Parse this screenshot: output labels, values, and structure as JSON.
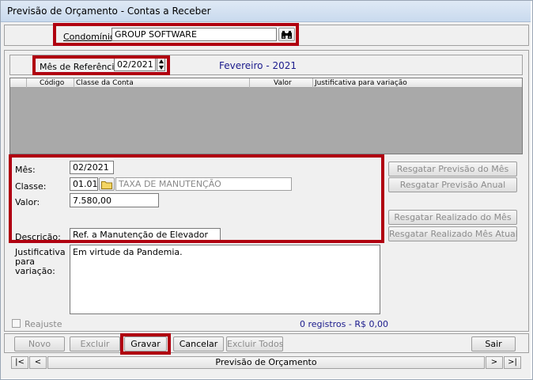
{
  "window": {
    "title": "Previsão de Orçamento - Contas a Receber"
  },
  "condominio": {
    "label": "Condomínio:",
    "value": "GROUP SOFTWARE",
    "search_icon": "binoculars-icon"
  },
  "referencia": {
    "label": "Mês de Referência:",
    "value": "02/2021",
    "display": "Fevereiro - 2021"
  },
  "grid": {
    "columns": [
      "Código",
      "Classe da Conta",
      "Valor",
      "Justificativa para variação"
    ]
  },
  "form": {
    "mes_label": "Mês:",
    "mes_value": "02/2021",
    "classe_label": "Classe:",
    "classe_code": "01.01",
    "classe_name": "TAXA DE MANUTENÇÃO",
    "valor_label": "Valor:",
    "valor_value": "7.580,00",
    "descricao_label": "Descrição:",
    "descricao_value": "Ref. a Manutenção de Elevador",
    "just_label_1": "Justificativa",
    "just_label_2": "para",
    "just_label_3": "variação:",
    "justificativa_value": "Em virtude da Pandemia."
  },
  "side_buttons": {
    "prev_mes": "Resgatar Previsão do Mês",
    "prev_anual": "Resgatar Previsão Anual",
    "real_mes": "Resgatar Realizado do Mês",
    "real_atual": "Resgatar Realizado Mês Atual"
  },
  "status": {
    "reajuste": "Reajuste",
    "registros": "0 registros - R$ 0,00"
  },
  "buttons": {
    "novo": "Novo",
    "excluir": "Excluir",
    "gravar": "Gravar",
    "cancelar": "Cancelar",
    "excluir_todos": "Excluir Todos",
    "sair": "Sair"
  },
  "navigator": {
    "first": "|<",
    "prev": "<",
    "label": "Previsão de Orçamento",
    "next": ">",
    "last": ">|"
  },
  "colors": {
    "accent_red": "#b00010",
    "header_blue": "#1a1a8c",
    "status_blue": "#1a1a8c"
  }
}
